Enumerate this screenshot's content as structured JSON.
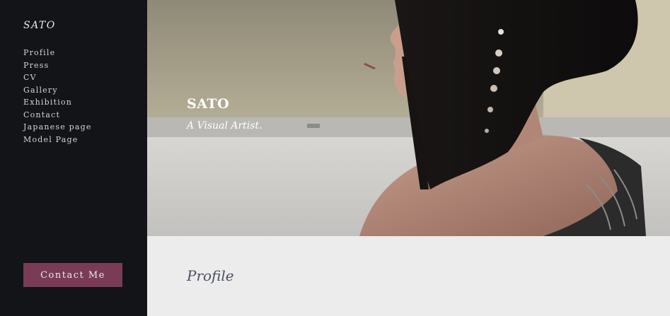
{
  "sidebar": {
    "logo": "SATO",
    "nav": [
      {
        "label": "Profile"
      },
      {
        "label": "Press"
      },
      {
        "label": "CV"
      },
      {
        "label": "Gallery"
      },
      {
        "label": "Exhibition"
      },
      {
        "label": "Contact"
      },
      {
        "label": "Japanese page"
      },
      {
        "label": "Model Page"
      }
    ],
    "contact_button": "Contact Me"
  },
  "hero": {
    "title": "SATO",
    "subtitle": "A Visual Artist.",
    "image": "portrait-photo"
  },
  "main": {
    "section_heading": "Profile"
  },
  "colors": {
    "sidebar_bg": "#131418",
    "accent": "#7a3b56",
    "content_bg": "#ececec",
    "heading": "#4b4e66"
  }
}
